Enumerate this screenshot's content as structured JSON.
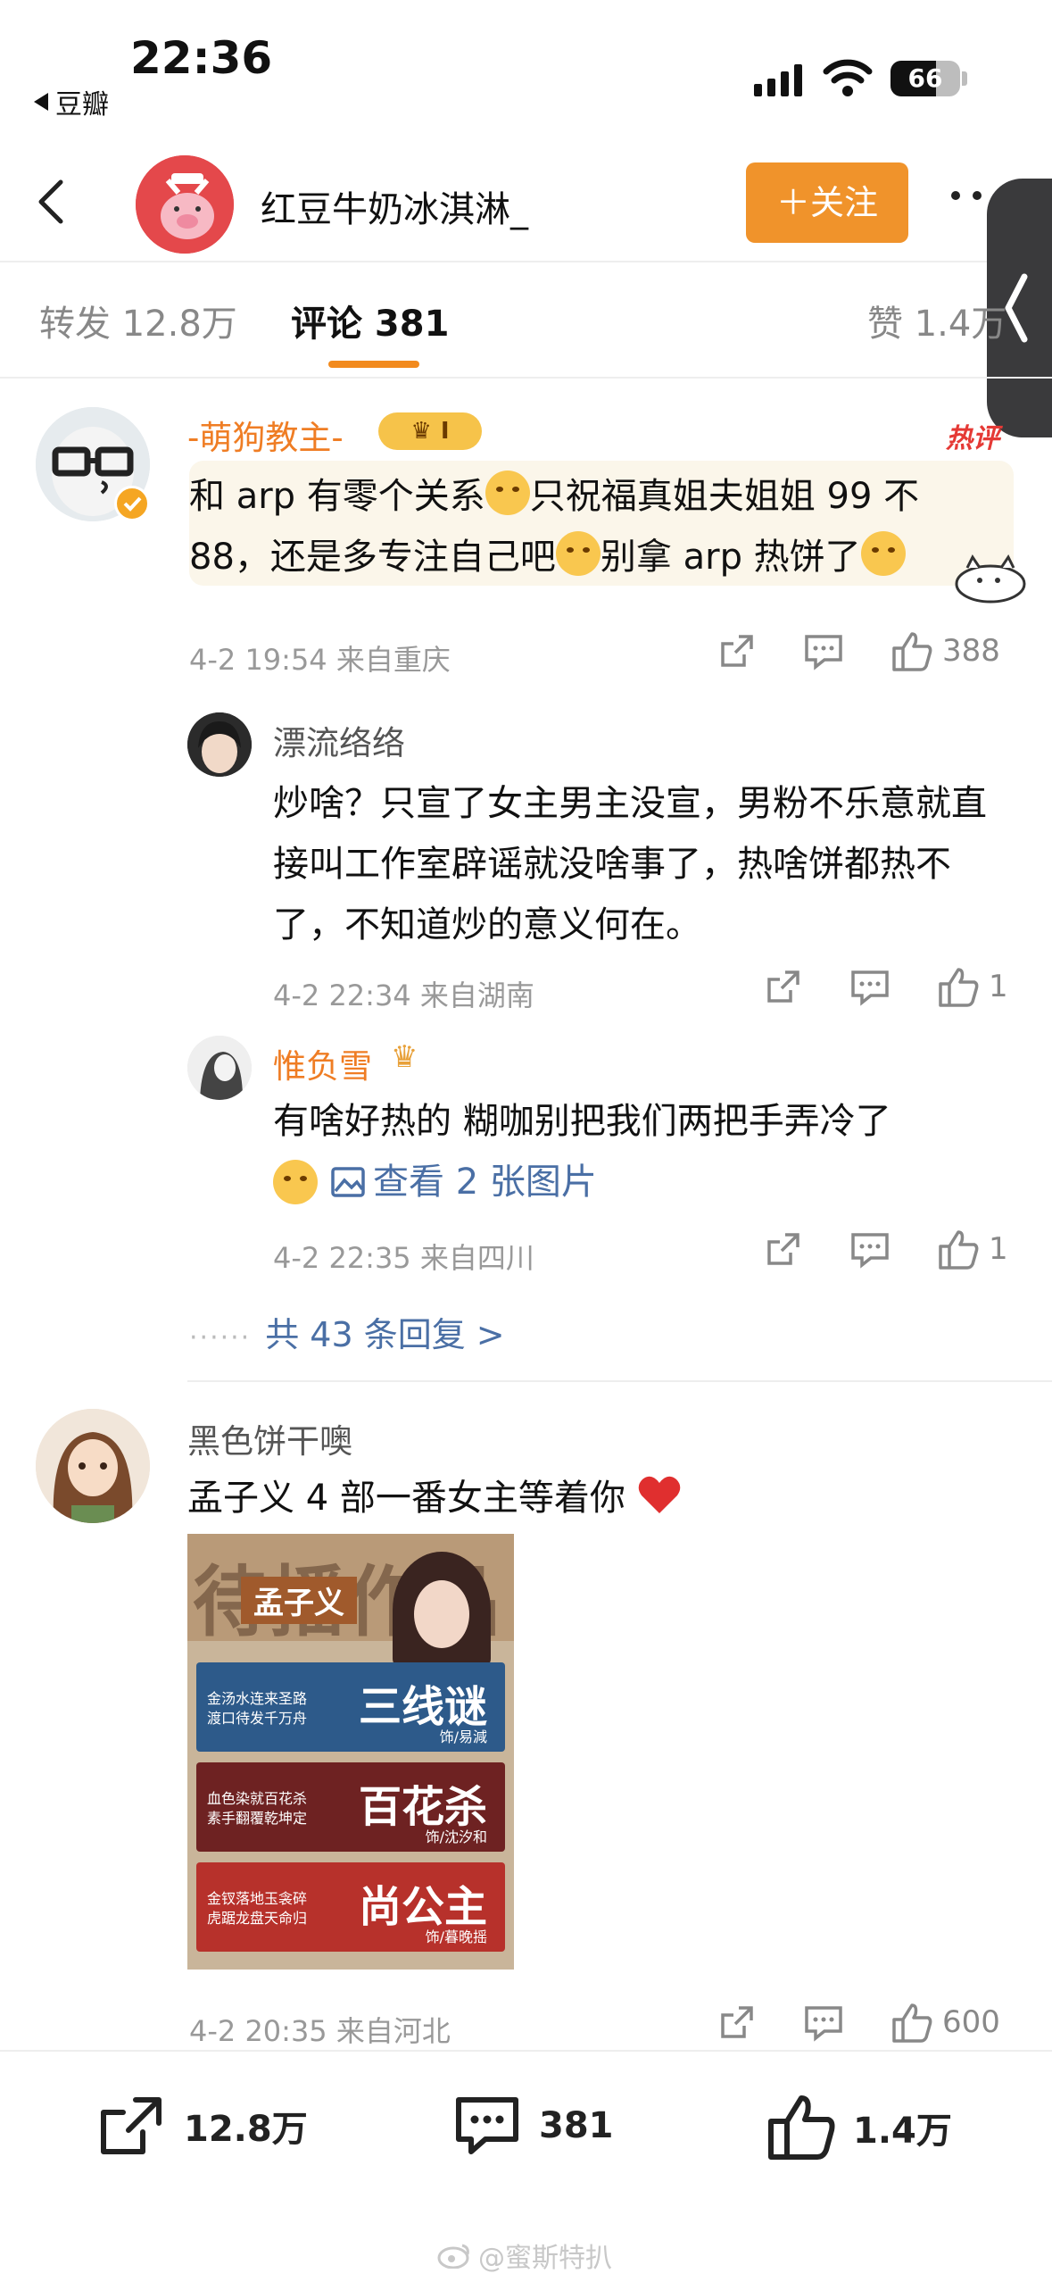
{
  "status_bar": {
    "time": "22:36",
    "back_app": "豆瓣",
    "battery": "66",
    "battery_level": 0.66
  },
  "header": {
    "user_name": "红豆牛奶冰淇淋_",
    "follow_label": "＋关注"
  },
  "tabs": [
    {
      "label": "转发 12.8万"
    },
    {
      "label": "评论 381"
    },
    {
      "label": "赞 1.4万"
    }
  ],
  "comments": [
    {
      "name": "-萌狗教主-",
      "badge": "I",
      "hot_tag": "热评",
      "text_line1_a": "和 arp 有零个关系",
      "text_line1_b": "只祝福真姐夫姐姐 99 不",
      "text_line2_a": "88，还是多专注自己吧",
      "text_line2_b": "别拿 arp 热饼了",
      "meta": "4-2 19:54  来自重庆",
      "likes": "388",
      "replies": [
        {
          "name": "漂流络络",
          "text": "炒啥？只宣了女主男主没宣，男粉不乐意就直接叫工作室辟谣就没啥事了，热啥饼都热不了，不知道炒的意义何在。",
          "meta": "4-2 22:34  来自湖南",
          "likes": "1"
        },
        {
          "name": "惟负雪",
          "text_line1": "有啥好热的 糊咖别把我们两把手弄冷了",
          "image_link": "查看 2 张图片",
          "meta": "4-2 22:35  来自四川",
          "likes": "1"
        }
      ],
      "more_replies": "共 43 条回复 >"
    },
    {
      "name": "黑色饼干噢",
      "text": "孟子义 4 部一番女主等着你",
      "poster": {
        "headline": "待播作品",
        "actress": "孟子义",
        "dramas": [
          {
            "title": "三线谜",
            "role": "饰/易減",
            "slogan": "金汤水连来圣路 渡口待发千万舟"
          },
          {
            "title": "百花杀",
            "role": "饰/沈汐和",
            "slogan": "血色染就百花杀 素手翻覆乾坤定"
          },
          {
            "title": "尚公主",
            "role": "饰/暮晚摇",
            "slogan": "金钗落地玉衾碎 虎踞龙盘天命归"
          }
        ]
      },
      "meta": "4-2 20:35  来自河北",
      "likes": "600"
    }
  ],
  "bottom_bar": {
    "repost": "12.8万",
    "comment": "381",
    "like": "1.4万"
  },
  "watermark": "@蜜斯特扒"
}
